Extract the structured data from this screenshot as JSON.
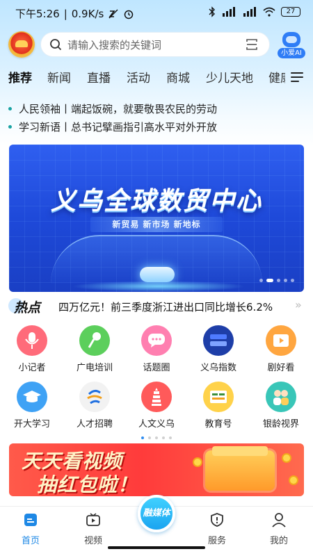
{
  "status_bar": {
    "time": "下午5:26",
    "speed": "0.9K/s",
    "battery": "27"
  },
  "search": {
    "placeholder": "请输入搜索的关键词"
  },
  "ai_assistant": {
    "label": "小爱AI"
  },
  "tabs": [
    {
      "label": "推荐",
      "active": true
    },
    {
      "label": "新闻"
    },
    {
      "label": "直播"
    },
    {
      "label": "活动"
    },
    {
      "label": "商城"
    },
    {
      "label": "少儿天地"
    },
    {
      "label": "健康"
    }
  ],
  "headlines": [
    "人民领袖丨端起饭碗，就要敬畏农民的劳动",
    "学习新语丨总书记擘画指引高水平对外开放"
  ],
  "banner": {
    "title": "义乌全球数贸中心",
    "subtitle": "新贸易 新市场 新地标"
  },
  "hotspot": {
    "badge": "热点",
    "text": "四万亿元！前三季度浙江进出口同比增长6.2%"
  },
  "grid": [
    {
      "label": "小记者",
      "icon": "microphone-icon",
      "color": "#ff6b7a"
    },
    {
      "label": "广电培训",
      "icon": "mic-training-icon",
      "color": "#5ccf5c"
    },
    {
      "label": "话题圈",
      "icon": "chat-bubble-icon",
      "color": "#ff7fb0"
    },
    {
      "label": "义乌指数",
      "icon": "yiwu-index-icon",
      "color": "#1e3ea8"
    },
    {
      "label": "剧好看",
      "icon": "film-play-icon",
      "color": "#ffa640"
    },
    {
      "label": "开大学习",
      "icon": "graduation-cap-icon",
      "color": "#3fa2f5"
    },
    {
      "label": "人才招聘",
      "icon": "talent-logo-icon",
      "color": "#f2f2f2"
    },
    {
      "label": "人文义乌",
      "icon": "pagoda-icon",
      "color": "#ff5a5a"
    },
    {
      "label": "教育号",
      "icon": "education-icon",
      "color": "#ffd24a"
    },
    {
      "label": "银龄视界",
      "icon": "elderly-couple-icon",
      "color": "#39c6b8"
    }
  ],
  "promo": {
    "line1": "天天看视频",
    "line2": "抽红包啦！"
  },
  "bottom_nav": [
    {
      "label": "首页",
      "icon": "home-icon",
      "active": true
    },
    {
      "label": "视频",
      "icon": "tv-icon"
    },
    {
      "label": "",
      "icon": "center-icon"
    },
    {
      "label": "服务",
      "icon": "shield-icon"
    },
    {
      "label": "我的",
      "icon": "user-icon"
    }
  ],
  "center_button": {
    "label": "融媒体"
  },
  "colors": {
    "accent": "#1e88e5",
    "headline_dot": "#17a2a2",
    "banner_blue": "#2f5ff0",
    "promo_red": "#ff3b3b"
  }
}
